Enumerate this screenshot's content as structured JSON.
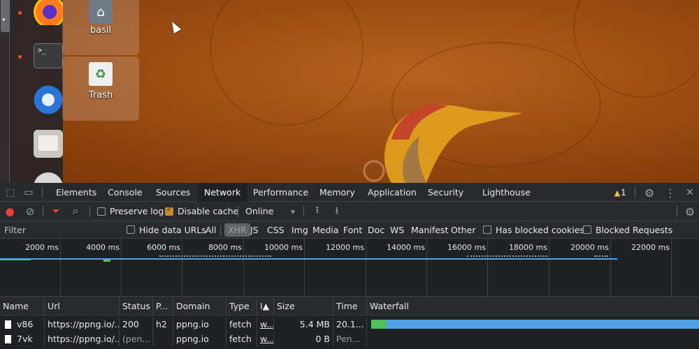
{
  "desktop": {
    "dock_items": [
      "firefox-icon",
      "terminal-icon",
      "thunderbird-icon",
      "files-icon",
      "help-icon"
    ],
    "terminal_prompt": ">_",
    "icons": {
      "home_label": "basil",
      "home_glyph": "⌂",
      "trash_label": "Trash",
      "trash_glyph": "♻"
    },
    "colors": {
      "wallpaper": "#9c4d12",
      "dock_indicator": "#e95420"
    }
  },
  "devtools": {
    "left_icons": {
      "inspect": "⬚",
      "device": "▭"
    },
    "tabs": [
      "Elements",
      "Console",
      "Sources",
      "Network",
      "Performance",
      "Memory",
      "Application",
      "Security",
      "Lighthouse"
    ],
    "active_tab": "Network",
    "warning": {
      "icon": "▲",
      "count": "1"
    },
    "right_icons": {
      "settings": "⚙",
      "more": "⋮",
      "close": "✕"
    },
    "toolbar": {
      "record": "●",
      "clear": "⊘",
      "filter_icon": "⏷",
      "search_icon": "⌕",
      "preserve_log": "Preserve log",
      "disable_cache": "Disable cache",
      "throttling": "Online",
      "throttling_caret": "▾",
      "upload": "⭱",
      "download": "⭳",
      "settings": "⚙"
    },
    "filterbar": {
      "placeholder": "Filter",
      "hide_data_urls": "Hide data URLs",
      "types": [
        "All",
        "XHR",
        "JS",
        "CSS",
        "Img",
        "Media",
        "Font",
        "Doc",
        "WS",
        "Manifest",
        "Other"
      ],
      "has_blocked_cookies": "Has blocked cookies",
      "blocked_requests": "Blocked Requests"
    },
    "timeline": {
      "ticks": [
        "2000 ms",
        "4000 ms",
        "6000 ms",
        "8000 ms",
        "10000 ms",
        "12000 ms",
        "14000 ms",
        "16000 ms",
        "18000 ms",
        "20000 ms",
        "22000 ms"
      ]
    },
    "table": {
      "headers": [
        "Name",
        "Url",
        "Status",
        "P...",
        "Domain",
        "Type",
        "I▲",
        "Size",
        "Time",
        "Waterfall"
      ],
      "rows": [
        {
          "name": "v86",
          "url": "https://ppng.io/...",
          "status": "200",
          "protocol": "h2",
          "domain": "ppng.io",
          "type": "fetch",
          "initiator": "w...",
          "size": "5.4 MB",
          "time": "20.1..."
        },
        {
          "name": "7vk",
          "url": "https://ppng.io/...",
          "status": "(pen...",
          "protocol": "",
          "domain": "ppng.io",
          "type": "fetch",
          "initiator": "w...",
          "size": "0 B",
          "time": "Pen..."
        }
      ]
    },
    "colors": {
      "bg": "#202124",
      "toolbar": "#292a2d",
      "record": "#e94235",
      "waterfall_blue": "#4aa3e2",
      "waterfall_green": "#4cc25a",
      "checkbox_on": "#c58a2a"
    }
  }
}
